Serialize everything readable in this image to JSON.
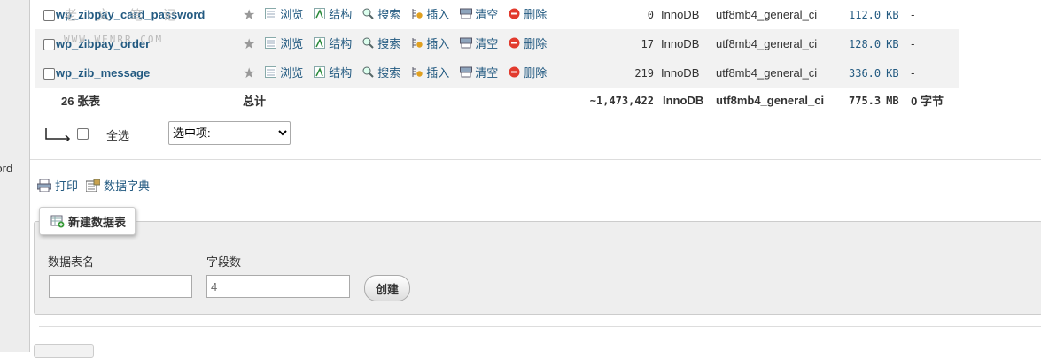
{
  "nav": {
    "partial_label": "word"
  },
  "watermark": {
    "text": "老 文 笔 记",
    "domain": "WWW.WENRR.COM"
  },
  "table": {
    "rows": [
      {
        "name": "wp_zibpay_card_password",
        "rows": "0",
        "engine": "InnoDB",
        "collation": "utf8mb4_general_ci",
        "size": "112.0",
        "unit": "KB",
        "overhead": "-"
      },
      {
        "name": "wp_zibpay_order",
        "rows": "17",
        "engine": "InnoDB",
        "collation": "utf8mb4_general_ci",
        "size": "128.0",
        "unit": "KB",
        "overhead": "-"
      },
      {
        "name": "wp_zib_message",
        "rows": "219",
        "engine": "InnoDB",
        "collation": "utf8mb4_general_ci",
        "size": "336.0",
        "unit": "KB",
        "overhead": "-"
      }
    ],
    "actions": {
      "browse": "浏览",
      "structure": "结构",
      "search": "搜索",
      "insert": "插入",
      "empty": "清空",
      "drop": "删除"
    },
    "total": {
      "count": "26 张表",
      "label": "总计",
      "rows": "~1,473,422",
      "engine": "InnoDB",
      "collation": "utf8mb4_general_ci",
      "size": "775.3",
      "unit": "MB",
      "overhead": "0 字节"
    }
  },
  "bulk": {
    "select_all": "全选",
    "with_selected": "选中项:"
  },
  "links": {
    "print": "打印",
    "data_dictionary": "数据字典"
  },
  "create": {
    "legend": "新建数据表",
    "name_label": "数据表名",
    "name_value": "",
    "fields_label": "字段数",
    "fields_value": "4",
    "submit": "创建"
  },
  "colors": {
    "link": "#235a81",
    "row_alt": "#f2f2f2",
    "panel": "#eeeeee",
    "drop_icon": "#e23b2e"
  }
}
